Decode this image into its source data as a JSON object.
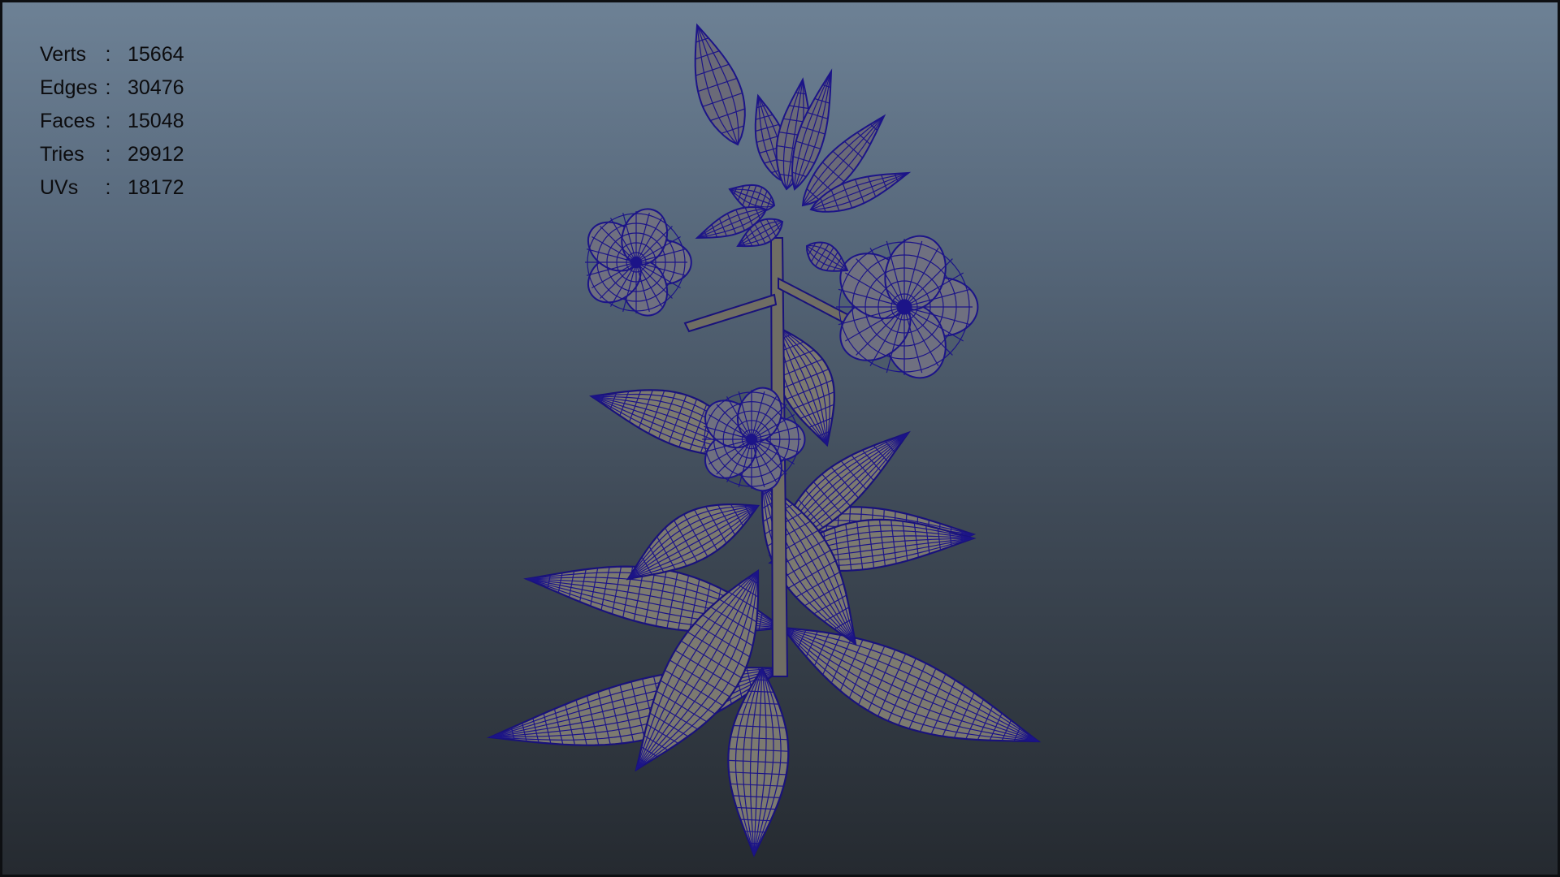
{
  "viewport": {
    "stats": [
      {
        "label": "Verts",
        "sep": ":",
        "value": "15664"
      },
      {
        "label": "Edges",
        "sep": ":",
        "value": "30476"
      },
      {
        "label": "Faces",
        "sep": ":",
        "value": "15048"
      },
      {
        "label": "Tries",
        "sep": ":",
        "value": "29912"
      },
      {
        "label": "UVs",
        "sep": ":",
        "value": "18172"
      }
    ],
    "colors": {
      "background_top": "#6d8195",
      "background_bottom": "#252a30",
      "wireframe": "#1c1488",
      "shaded": "#7c7a70",
      "hud_text": "#0c0c0e"
    }
  }
}
